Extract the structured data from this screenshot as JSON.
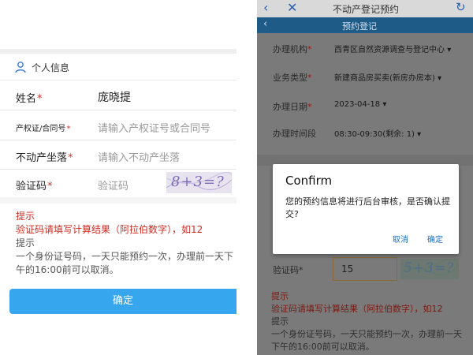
{
  "left": {
    "section_title": "个人信息",
    "rows": [
      {
        "label": "姓名",
        "value": "庞晓提",
        "placeholder": ""
      },
      {
        "label": "产权证/合同号",
        "value": "",
        "placeholder": "请输入产权证号或合同号"
      },
      {
        "label": "不动产坐落",
        "value": "",
        "placeholder": "请输入不动产坐落"
      },
      {
        "label": "验证码",
        "value": "",
        "placeholder": "验证码"
      }
    ],
    "required_mark": "*",
    "captcha_text": "8+3=?",
    "tip": {
      "title": "提示",
      "line1": "验证码请填写计算结果（阿拉伯数字），如12",
      "title2": "提示",
      "line2": "一个身份证号码，一天只能预约一次，办理前一天下午的16:00前可以取消。"
    },
    "confirm_label": "确定"
  },
  "right": {
    "header": {
      "back_icon": "‹",
      "close_icon": "✕",
      "title": "不动产登记预约",
      "refresh_icon": "↻"
    },
    "subheader": {
      "chevron": "‹",
      "title": "预约登记"
    },
    "rows": [
      {
        "label": "办理机构",
        "value": "西青区自然资源调查与登记中心"
      },
      {
        "label": "业务类型",
        "value": "新建商品房买卖(新房办房本)"
      },
      {
        "label": "办理日期",
        "value": "2023-04-18"
      },
      {
        "label": "办理时间段",
        "value": "08:30-09:30(剩余: 1)"
      }
    ],
    "required_mark": "*",
    "dropdown_arrow": "▾",
    "verify_label": "验证码",
    "verify_value": "15",
    "captcha_text": "5+3=?",
    "tip": {
      "title": "提示",
      "line1": "验证码请填写计算结果（阿拉伯数字），如12",
      "title2": "提示",
      "line2": "一个身份证号码，一天只能预约一次，办理前一天下午的16:00前可以取消。"
    },
    "dialog": {
      "title": "Confirm",
      "message": "您的预约信息将进行后台审核，是否确认提交?",
      "cancel": "取消",
      "ok": "确定"
    }
  }
}
